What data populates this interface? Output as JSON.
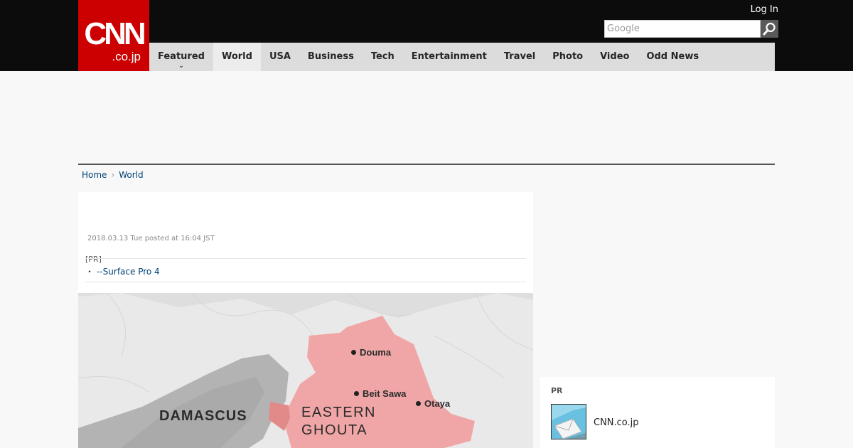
{
  "header": {
    "logo_brand": "CNN",
    "logo_suffix": ".co.jp",
    "login_label": "Log In",
    "search_placeholder": "Google"
  },
  "nav": {
    "items": [
      {
        "label": "Featured"
      },
      {
        "label": "World"
      },
      {
        "label": "USA"
      },
      {
        "label": "Business"
      },
      {
        "label": "Tech"
      },
      {
        "label": "Entertainment"
      },
      {
        "label": "Travel"
      },
      {
        "label": "Photo"
      },
      {
        "label": "Video"
      },
      {
        "label": "Odd News"
      }
    ],
    "active": "World"
  },
  "breadcrumb": {
    "home": "Home",
    "current": "World"
  },
  "article": {
    "posted": "2018.03.13 Tue posted at 16:04 JST",
    "pr_label": "[PR]",
    "pr_bullet": "・",
    "pr_link": "--Surface Pro 4"
  },
  "map": {
    "city": "DAMASCUS",
    "region_line1": "EASTERN",
    "region_line2": "GHOUTA",
    "towns": [
      "Douma",
      "Beit Sawa",
      "Otaya"
    ],
    "region_color": "#f0a6a6"
  },
  "sidebar": {
    "pr_label": "PR",
    "pr_item": "CNN.co.jp"
  },
  "colors": {
    "brand_red": "#cc0000",
    "topbar": "#0c0c0c",
    "link": "#004276"
  }
}
